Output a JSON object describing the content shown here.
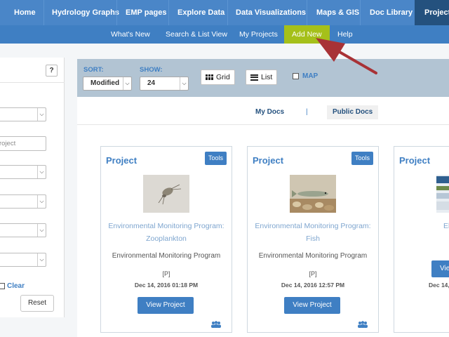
{
  "topnav": {
    "items": [
      "Home",
      "Hydrology Graphs",
      "EMP pages",
      "Explore Data",
      "Data Visualizations",
      "Maps & GIS",
      "Doc Library",
      "Projects"
    ]
  },
  "subnav": {
    "items": [
      "What's New",
      "Search & List View",
      "My Projects",
      "Add New",
      "Help"
    ]
  },
  "filter_panel": {
    "help_label": "?",
    "project_placeholder": "roject",
    "clear_label": "Clear",
    "reset_label": "Reset"
  },
  "toolbar": {
    "sort_label": "SORT:",
    "sort_value": "Modified",
    "show_label": "SHOW:",
    "show_value": "24",
    "grid_label": "Grid",
    "list_label": "List",
    "map_label": "MAP"
  },
  "doc_tabs": {
    "my_docs": "My Docs",
    "separator": "|",
    "public_docs": "Public Docs"
  },
  "cards": [
    {
      "title": "Project",
      "tools_label": "Tools",
      "link_line1": "Environmental Monitoring Program:",
      "link_line2": "Zooplankton",
      "program": "Environmental Monitoring Program",
      "flag": "[P]",
      "date": "Dec 14, 2016 01:18 PM",
      "view_label": "View Project"
    },
    {
      "title": "Project",
      "tools_label": "Tools",
      "link_line1": "Environmental Monitoring Program:",
      "link_line2": "Fish",
      "program": "Environmental Monitoring Program",
      "flag": "[P]",
      "date": "Dec 14, 2016 12:57 PM",
      "view_label": "View Project"
    },
    {
      "title": "Project",
      "link_line1": "El",
      "date": "Dec 14,",
      "view_label": "Vie"
    }
  ],
  "colors": {
    "nav_blue": "#4a86c8",
    "nav_active": "#24517e",
    "add_new_green": "#a5c01a",
    "toolbar_gray": "#b2c4d3",
    "arrow_red": "#a83236"
  }
}
